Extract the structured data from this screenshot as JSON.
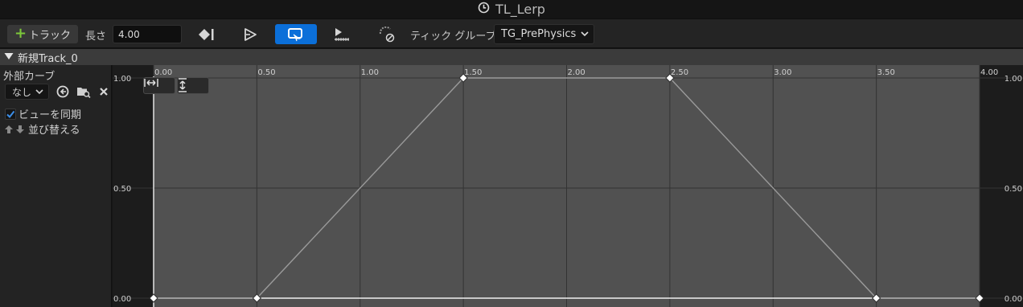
{
  "window": {
    "title": "TL_Lerp"
  },
  "toolbar": {
    "add_track_label": "トラック",
    "length_label": "長さ",
    "length_value": "4.00",
    "tick_group_label": "ティック グループ",
    "tick_group_value": "TG_PrePhysics",
    "loop_active": true
  },
  "track": {
    "name": "新規Track_0"
  },
  "left_panel": {
    "external_curve_label": "外部カーブ",
    "external_curve_value": "なし",
    "sync_view_label": "ビューを同期",
    "sync_view_checked": true,
    "sort_label": "並び替える"
  },
  "graph": {
    "x_ticks": [
      "0.00",
      "0.50",
      "1.00",
      "1.50",
      "2.00",
      "2.50",
      "3.00",
      "3.50",
      "4.00"
    ],
    "y_ticks": [
      "1.00",
      "0.50",
      "0.00"
    ],
    "x_range": [
      0,
      4
    ],
    "y_range": [
      0,
      1
    ]
  },
  "chart_data": {
    "type": "line",
    "x": [
      0,
      0.5,
      1.5,
      2.5,
      3.5,
      4.0
    ],
    "y": [
      0,
      0,
      1,
      1,
      0,
      0
    ],
    "xlim": [
      0,
      4
    ],
    "ylim": [
      0,
      1
    ],
    "grid": true
  },
  "colors": {
    "accent": "#0b6fd9",
    "plus": "#7cc83a",
    "curve": "#9a9a9a",
    "active_range": "#515151"
  }
}
